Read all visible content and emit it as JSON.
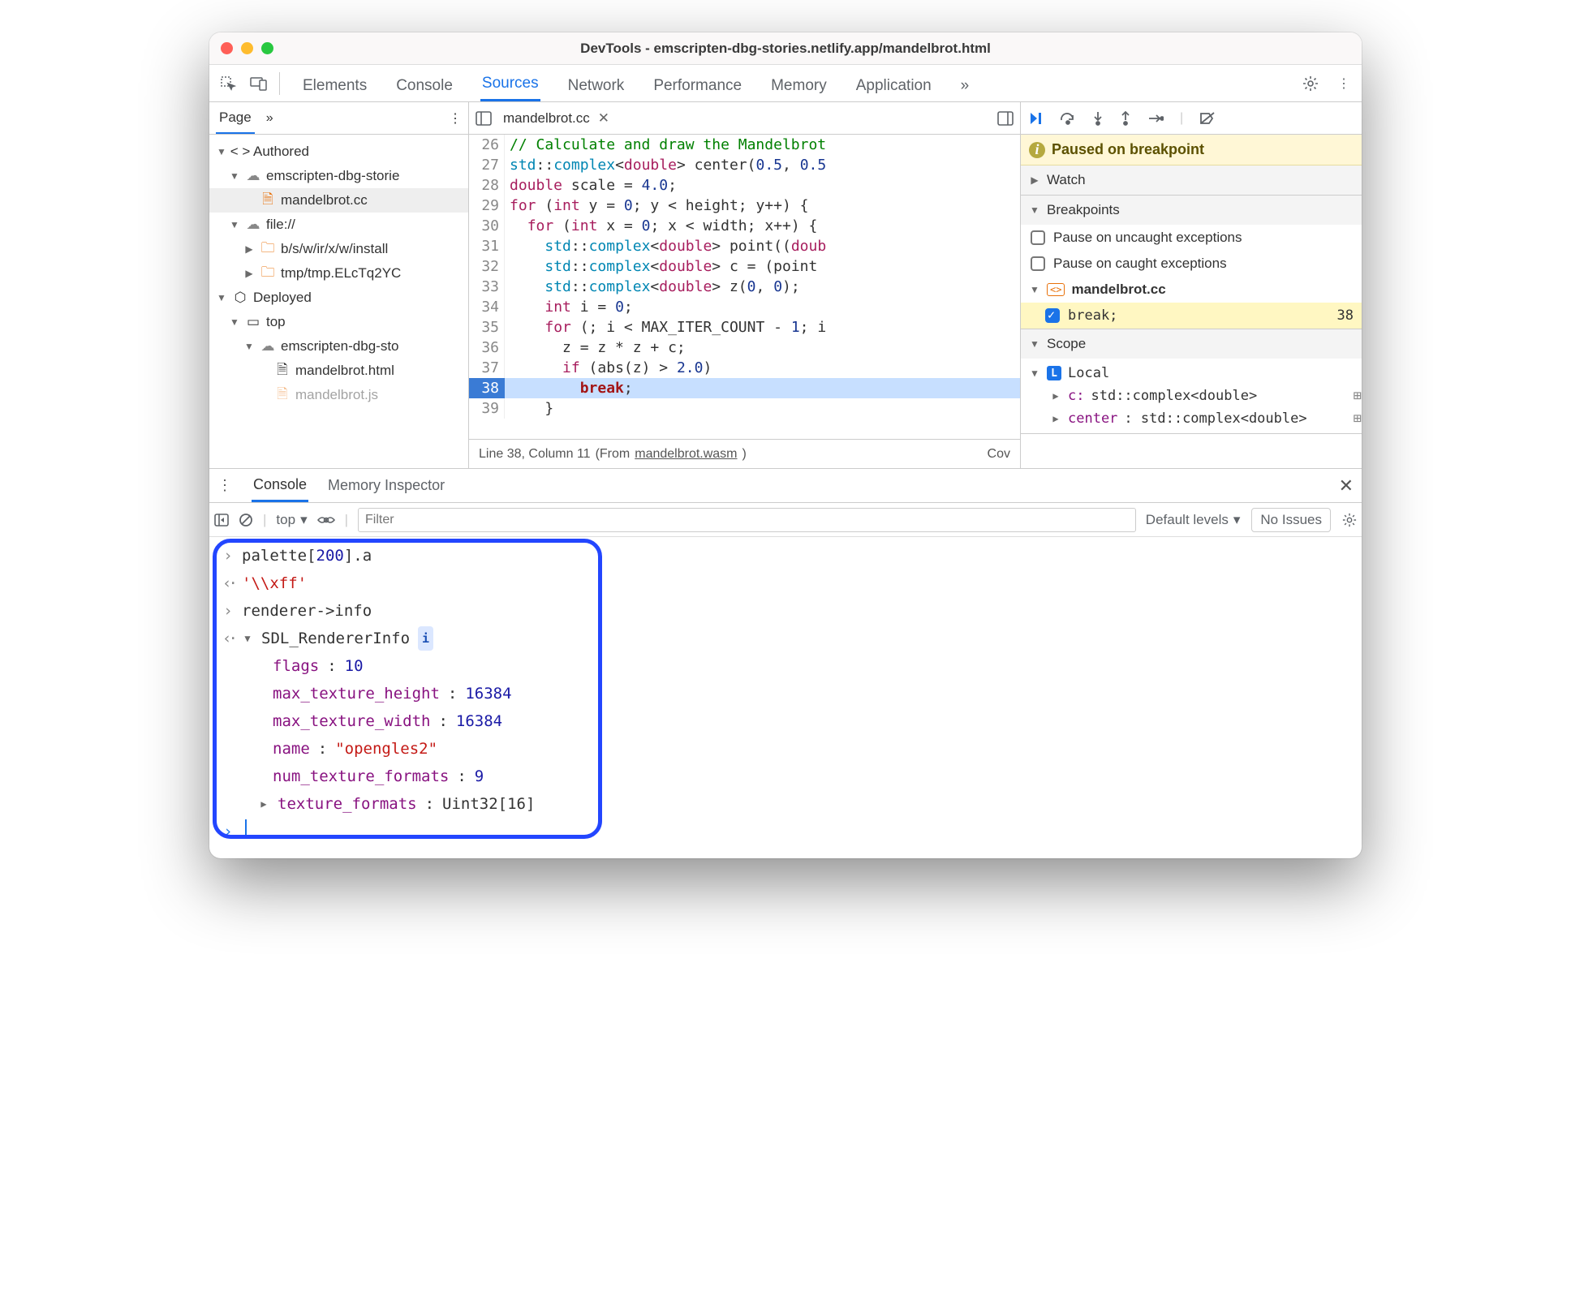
{
  "window": {
    "title": "DevTools - emscripten-dbg-stories.netlify.app/mandelbrot.html"
  },
  "tabs": {
    "items": [
      "Elements",
      "Console",
      "Sources",
      "Network",
      "Performance",
      "Memory",
      "Application"
    ],
    "active": "Sources"
  },
  "nav": {
    "page_label": "Page",
    "tree": {
      "authored": "Authored",
      "domain": "emscripten-dbg-storie",
      "file_cc": "mandelbrot.cc",
      "file_scheme": "file://",
      "folder1": "b/s/w/ir/x/w/install",
      "folder2": "tmp/tmp.ELcTq2YC",
      "deployed": "Deployed",
      "top": "top",
      "domain2": "emscripten-dbg-sto",
      "file_html": "mandelbrot.html",
      "file_js": "mandelbrot.js"
    }
  },
  "editor": {
    "file_tab": "mandelbrot.cc",
    "lines": [
      {
        "n": 26,
        "html": "<span class='cm'>// Calculate and draw the Mandelbrot</span>"
      },
      {
        "n": 27,
        "html": "<span class='ty'>std</span>::<span class='ty'>complex</span>&lt;<span class='kw'>double</span>&gt; center(<span class='num'>0.5</span>, <span class='num'>0.5</span>"
      },
      {
        "n": 28,
        "html": "<span class='kw'>double</span> scale = <span class='num'>4.0</span>;"
      },
      {
        "n": 29,
        "html": "<span class='kw'>for</span> (<span class='kw'>int</span> y = <span class='num'>0</span>; y &lt; height; y++) {"
      },
      {
        "n": 30,
        "html": "  <span class='kw'>for</span> (<span class='kw'>int</span> x = <span class='num'>0</span>; x &lt; width; x++) {"
      },
      {
        "n": 31,
        "html": "    <span class='ty'>std</span>::<span class='ty'>complex</span>&lt;<span class='kw'>double</span>&gt; point((<span class='kw'>doub</span>"
      },
      {
        "n": 32,
        "html": "    <span class='ty'>std</span>::<span class='ty'>complex</span>&lt;<span class='kw'>double</span>&gt; c = (point "
      },
      {
        "n": 33,
        "html": "    <span class='ty'>std</span>::<span class='ty'>complex</span>&lt;<span class='kw'>double</span>&gt; z(<span class='num'>0</span>, <span class='num'>0</span>);"
      },
      {
        "n": 34,
        "html": "    <span class='kw'>int</span> i = <span class='num'>0</span>;"
      },
      {
        "n": 35,
        "html": "    <span class='kw'>for</span> (; i &lt; MAX_ITER_COUNT - <span class='num'>1</span>; i"
      },
      {
        "n": 36,
        "html": "      z = z * z + c;"
      },
      {
        "n": 37,
        "html": "      <span class='kw'>if</span> (abs(z) &gt; <span class='num'>2.0</span>)"
      },
      {
        "n": 38,
        "html": "        <span class='brk'>break</span>;",
        "hl": true
      },
      {
        "n": 39,
        "html": "    }"
      }
    ],
    "status": {
      "pos": "Line 38, Column 11",
      "from": "(From ",
      "wasm": "mandelbrot.wasm",
      "close": ")",
      "cov": "Cov"
    }
  },
  "debugger": {
    "paused": "Paused on breakpoint",
    "watch": "Watch",
    "breakpoints_label": "Breakpoints",
    "uncaught": "Pause on uncaught exceptions",
    "caught": "Pause on caught exceptions",
    "bp_file": "mandelbrot.cc",
    "bp_code": "break;",
    "bp_line": "38",
    "scope_label": "Scope",
    "local_label": "Local",
    "scope": {
      "c_key": "c:",
      "c_val": "std::complex<double>",
      "center_key": "center",
      "center_val": ": std::complex<double>"
    }
  },
  "drawer": {
    "console_tab": "Console",
    "mem_tab": "Memory Inspector",
    "context": "top",
    "filter_ph": "Filter",
    "levels": "Default levels",
    "issues": "No Issues"
  },
  "console": {
    "in1": "palette[200].a",
    "out1": "'\\\\xff'",
    "in2": "renderer->info",
    "obj_name": "SDL_RendererInfo",
    "props": {
      "flags": "10",
      "max_texture_height": "16384",
      "max_texture_width": "16384",
      "name": "\"opengles2\"",
      "num_texture_formats": "9",
      "texture_formats": "Uint32[16]"
    }
  }
}
